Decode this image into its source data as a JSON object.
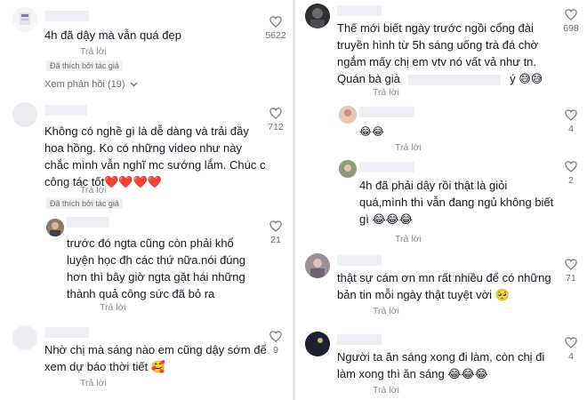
{
  "left": [
    {
      "text": "4h đã dậy mà vẫn quá đẹp",
      "reply": "Trả lời",
      "liked_badge": "Đã thích bởi tác giả",
      "view_replies": "Xem phản hồi (19)",
      "likes": "5622"
    },
    {
      "text_lines": [
        "Không có nghề gì là dễ dàng và trải đầy",
        "hoa hồng. Ko có những video như này",
        "chắc mình vẫn nghĩ mc sướng lắm. Chúc c",
        "công tác tốt❤️❤️❤️❤️"
      ],
      "reply": "Trả lời",
      "liked_badge": "Đã thích bởi tác giả",
      "likes": "712"
    },
    {
      "text_lines": [
        "trước đó ngta cũng còn phải khổ",
        "luyện học đh các thứ nữa.nói đúng",
        "hơn thì bây giờ ngta gặt hái những",
        "thành quả công sức đã bỏ ra"
      ],
      "reply": "Trả lời",
      "likes": "21"
    },
    {
      "text_lines": [
        "Nhờ chị mà sáng nào em cũng dậy sớm để",
        "xem dự báo thời tiết 🥰"
      ],
      "reply": "Trả lời",
      "likes": "9"
    }
  ],
  "right": [
    {
      "text_lines": [
        "Thế mới biết ngày trước ngồi cổng đài",
        "truyền hình từ 5h sáng uống trà đá chờ",
        "ngắm mấy chị em vtv nó vất vả như tn.",
        "Quán bà già",
        "ý 😅😅"
      ],
      "reply": "Trả lời",
      "likes": "698"
    },
    {
      "text": "😂😂",
      "reply": "Trả lời",
      "likes": "4"
    },
    {
      "text_lines": [
        "4h đã phải dậy rồi thật là giỏi",
        "quá,mình thì vẫn đang ngủ không biết",
        "gì 😂😂😂"
      ],
      "reply": "Trả lời",
      "likes": "2"
    },
    {
      "text_lines": [
        "thật sự cám ơn mn rất nhiều để có những",
        "bản tin mỗi ngày thật tuyệt vời 🥺"
      ],
      "reply": "Trả lời",
      "likes": "71"
    },
    {
      "text_lines": [
        "Người ta ăn sáng xong đi làm, còn chị đi",
        "làm xong thì ăn sáng 😂😂😂"
      ],
      "reply": "Trả lời",
      "likes": "4"
    }
  ]
}
